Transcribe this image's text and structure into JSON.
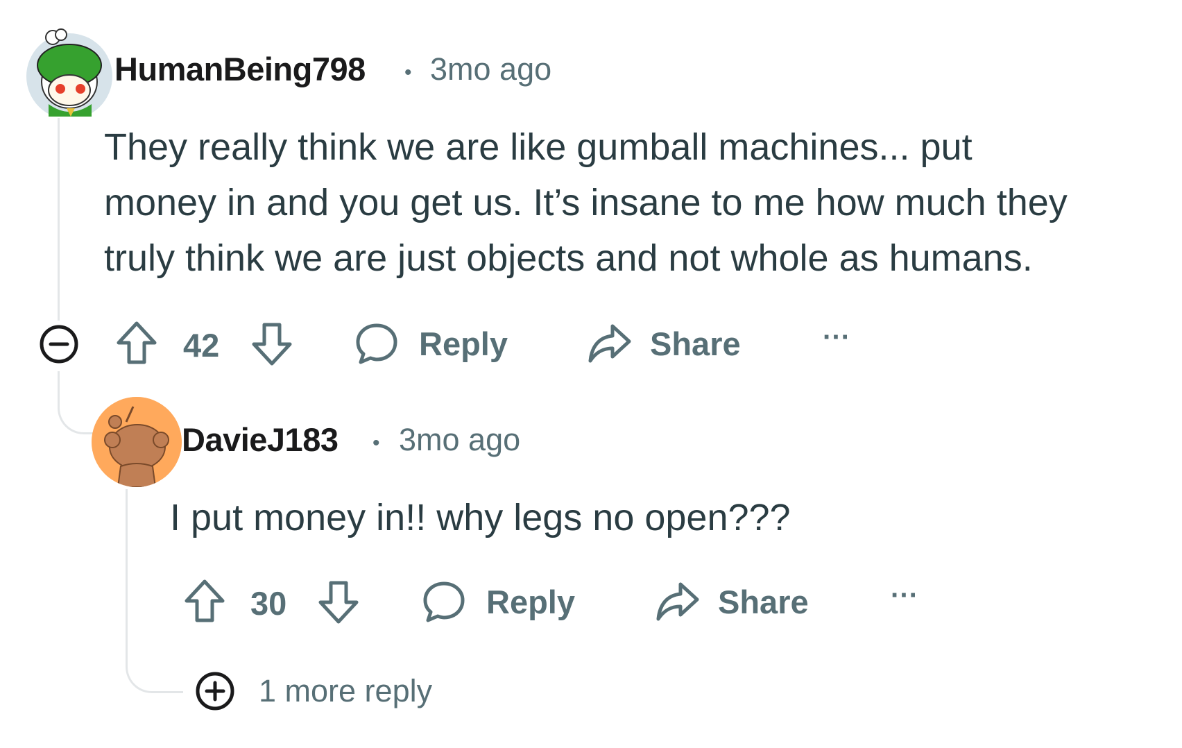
{
  "comments": [
    {
      "username": "HumanBeing798",
      "separator": "•",
      "time": "3mo ago",
      "body_lines": [
        "They really think we are like gumball machines... put",
        "money in and you get us. It’s insane to me how much they",
        "truly think we are just objects and not whole as humans."
      ],
      "votes": "42",
      "reply_label": "Reply",
      "share_label": "Share",
      "more_label": "···"
    },
    {
      "username": "DavieJ183",
      "separator": "•",
      "time": "3mo ago",
      "body_lines": [
        "I put money in!! why legs no open???"
      ],
      "votes": "30",
      "reply_label": "Reply",
      "share_label": "Share",
      "more_label": "···"
    }
  ],
  "more_replies": "1 more reply",
  "icons": {
    "collapse": "collapse-icon",
    "expand": "expand-icon",
    "upvote": "upvote-icon",
    "downvote": "downvote-icon",
    "reply": "reply-bubble-icon",
    "share": "share-arrow-icon"
  },
  "colors": {
    "text_primary": "#1a1a1b",
    "text_body": "#2a3c42",
    "text_meta": "#576f76",
    "thread_line": "#e3e6e8",
    "avatar2_bg": "#ffa95c"
  }
}
